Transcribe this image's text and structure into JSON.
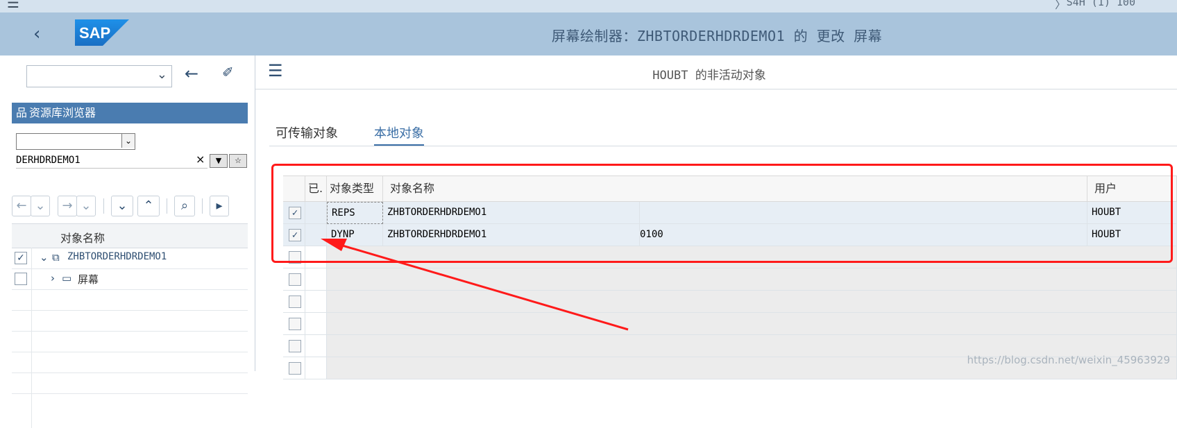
{
  "top_strip": {
    "system": "S4H (1) 100",
    "chevron": "〉"
  },
  "header": {
    "back_icon": "‹",
    "logo": "SAP",
    "title": "屏幕绘制器：ZHBTORDERHDRDEMO1 的 更改 屏幕"
  },
  "left": {
    "dropdown_value": "",
    "repository_browser": "资源库浏览器",
    "object_type_value": "",
    "object_name_value": "DERHDRDEMO1",
    "clear_icon": "×",
    "tree_header": "对象名称",
    "tree": [
      {
        "label": "ZHBTORDERHDRDEMO1",
        "checked": true,
        "expanded": true,
        "level": 0
      },
      {
        "label": "屏幕",
        "checked": false,
        "expanded": false,
        "level": 1
      }
    ]
  },
  "right": {
    "subtitle": "HOUBT 的非活动对象",
    "tabs": [
      {
        "label": "可传输对象",
        "active": false
      },
      {
        "label": "本地对象",
        "active": true
      }
    ],
    "columns": {
      "checked": "已.",
      "type": "对象类型",
      "name": "对象名称",
      "user": "用户"
    },
    "rows": [
      {
        "checked": true,
        "type": "REPS",
        "name": "ZHBTORDERHDRDEMO1",
        "extra": "",
        "user": "HOUBT"
      },
      {
        "checked": true,
        "type": "DYNP",
        "name": "ZHBTORDERHDRDEMO1",
        "extra": "0100",
        "user": "HOUBT"
      }
    ],
    "empty_rows": 6
  },
  "watermark": "https://blog.csdn.net/weixin_45963929",
  "colors": {
    "header": "#a9c4dc",
    "accent": "#4a7cb0",
    "highlight": "#ff1a1a"
  }
}
